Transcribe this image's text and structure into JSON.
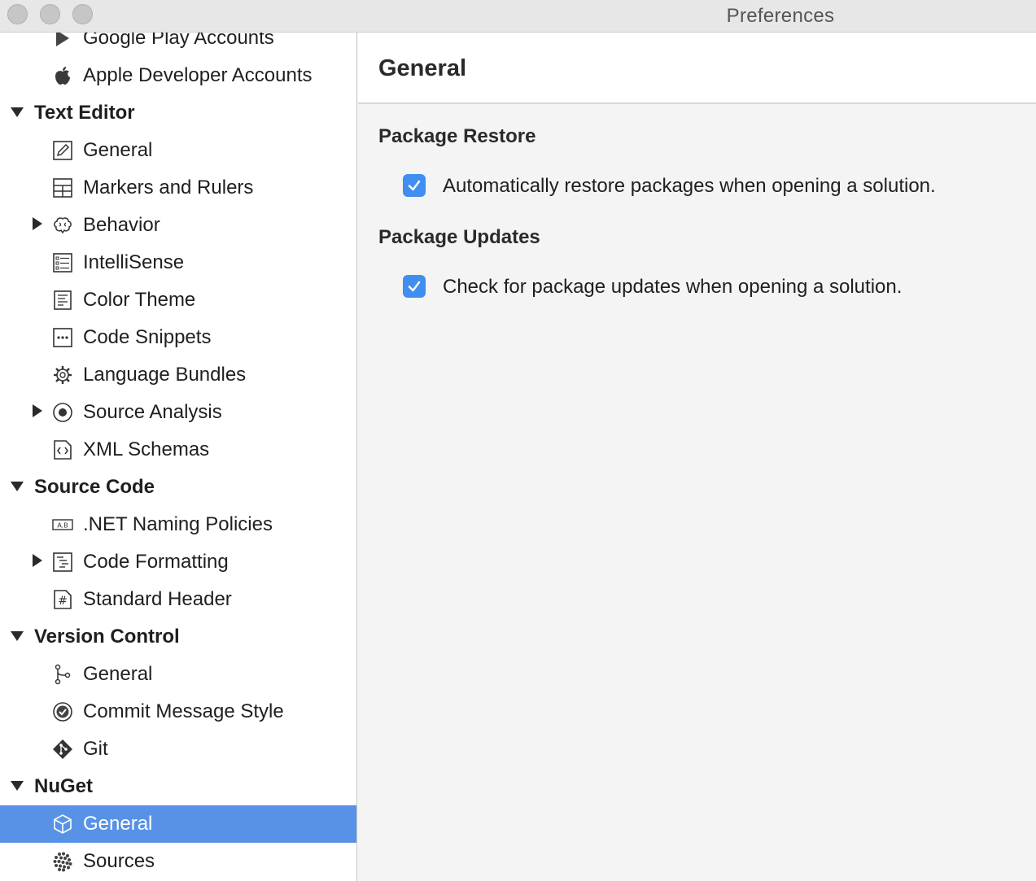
{
  "window": {
    "title": "Preferences"
  },
  "sidebar": {
    "rows": [
      {
        "kind": "item",
        "label": "Google Play Accounts",
        "icon": "google-play-icon"
      },
      {
        "kind": "item",
        "label": "Apple Developer Accounts",
        "icon": "apple-icon"
      },
      {
        "kind": "group",
        "label": "Text Editor",
        "expanded": true
      },
      {
        "kind": "item",
        "label": "General",
        "icon": "pencil-icon"
      },
      {
        "kind": "item",
        "label": "Markers and Rulers",
        "icon": "grid-icon"
      },
      {
        "kind": "item",
        "label": "Behavior",
        "icon": "brain-icon",
        "collapsed_children": true
      },
      {
        "kind": "item",
        "label": "IntelliSense",
        "icon": "list-icon"
      },
      {
        "kind": "item",
        "label": "Color Theme",
        "icon": "document-lines-icon"
      },
      {
        "kind": "item",
        "label": "Code Snippets",
        "icon": "dots-box-icon"
      },
      {
        "kind": "item",
        "label": "Language Bundles",
        "icon": "gear-icon"
      },
      {
        "kind": "item",
        "label": "Source Analysis",
        "icon": "radio-target-icon",
        "collapsed_children": true
      },
      {
        "kind": "item",
        "label": "XML Schemas",
        "icon": "code-file-icon"
      },
      {
        "kind": "group",
        "label": "Source Code",
        "expanded": true
      },
      {
        "kind": "item",
        "label": ".NET Naming Policies",
        "icon": "naming-icon"
      },
      {
        "kind": "item",
        "label": "Code Formatting",
        "icon": "format-icon",
        "collapsed_children": true
      },
      {
        "kind": "item",
        "label": "Standard Header",
        "icon": "hash-file-icon"
      },
      {
        "kind": "group",
        "label": "Version Control",
        "expanded": true
      },
      {
        "kind": "item",
        "label": "General",
        "icon": "branch-icon"
      },
      {
        "kind": "item",
        "label": "Commit Message Style",
        "icon": "check-circle-icon"
      },
      {
        "kind": "item",
        "label": "Git",
        "icon": "git-icon"
      },
      {
        "kind": "group",
        "label": "NuGet",
        "expanded": true
      },
      {
        "kind": "item",
        "label": "General",
        "icon": "package-icon",
        "selected": true
      },
      {
        "kind": "item",
        "label": "Sources",
        "icon": "sources-icon"
      }
    ]
  },
  "main": {
    "title": "General",
    "sections": [
      {
        "title": "Package Restore",
        "option": {
          "label": "Automatically restore packages when opening a solution.",
          "checked": true
        }
      },
      {
        "title": "Package Updates",
        "option": {
          "label": "Check for package updates when opening a solution.",
          "checked": true
        }
      }
    ]
  },
  "colors": {
    "selection": "#5792e7",
    "checkbox": "#3f8ef0"
  }
}
